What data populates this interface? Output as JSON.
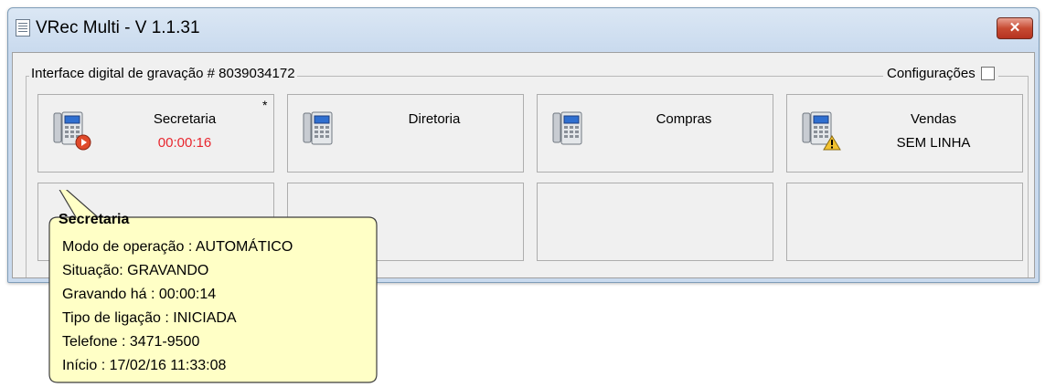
{
  "window": {
    "title": "VRec Multi - V 1.1.31",
    "close_symbol": "✕"
  },
  "group": {
    "caption": "Interface digital de gravação # 8039034172",
    "config_label": "Configurações"
  },
  "channels": [
    {
      "name": "Secretaria",
      "status": "00:00:16",
      "status_color": "#e8262e",
      "marker": "*",
      "icon": "phone-recording-icon"
    },
    {
      "name": "Diretoria",
      "status": "",
      "status_color": "#000000",
      "marker": "",
      "icon": "phone-icon"
    },
    {
      "name": "Compras",
      "status": "",
      "status_color": "#000000",
      "marker": "",
      "icon": "phone-icon"
    },
    {
      "name": "Vendas",
      "status": "SEM LINHA",
      "status_color": "#000000",
      "marker": "",
      "icon": "phone-warning-icon"
    }
  ],
  "tooltip": {
    "title": "Secretaria",
    "lines": [
      "Modo de operação : AUTOMÁTICO",
      "Situação: GRAVANDO",
      "Gravando há : 00:00:14",
      "Tipo de ligação : INICIADA",
      "Telefone : 3471-9500",
      "Início : 17/02/16 11:33:08"
    ]
  },
  "colors": {
    "recording": "#e8262e",
    "tooltip_bg": "#ffffc6",
    "warning": "#f2c230"
  }
}
